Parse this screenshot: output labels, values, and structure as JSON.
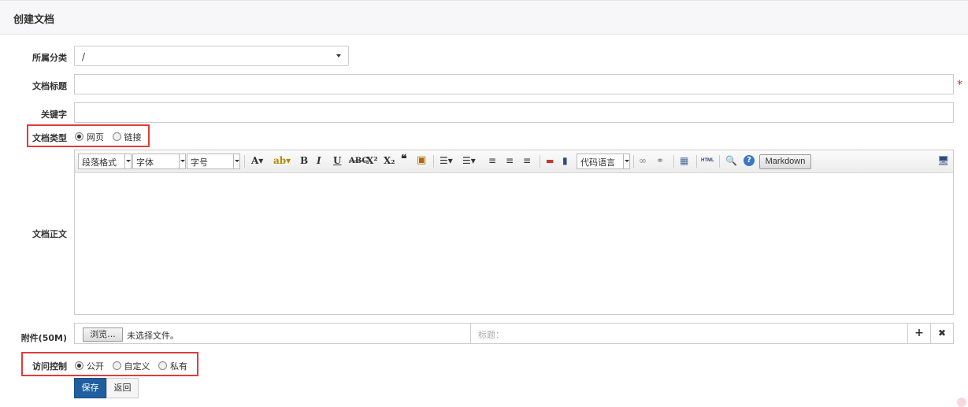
{
  "header": {
    "title": "创建文档"
  },
  "form": {
    "category": {
      "label": "所属分类",
      "value": "/"
    },
    "title": {
      "label": "文档标题",
      "value": "",
      "required_mark": "*"
    },
    "keywords": {
      "label": "关键字",
      "value": ""
    },
    "doc_type": {
      "label": "文档类型",
      "options": [
        "网页",
        "链接"
      ],
      "selected": "网页"
    },
    "body": {
      "label": "文档正文"
    },
    "attachment": {
      "label": "附件(50M)",
      "browse": "浏览...",
      "no_file": "未选择文件。",
      "title_placeholder": "标题：",
      "add_icon": "+",
      "remove_icon": "✖"
    },
    "access": {
      "label": "访问控制",
      "options": [
        "公开",
        "自定义",
        "私有"
      ],
      "selected": "公开"
    }
  },
  "toolbar": {
    "paragraph": "段落格式",
    "font": "字体",
    "size": "字号",
    "code_lang": "代码语言",
    "markdown": "Markdown",
    "html_badge": "HTML"
  },
  "actions": {
    "save": "保存",
    "back": "返回"
  },
  "colors": {
    "accent": "#1f5fa0",
    "highlight_box": "#e23b3b",
    "required": "#c9302c"
  }
}
